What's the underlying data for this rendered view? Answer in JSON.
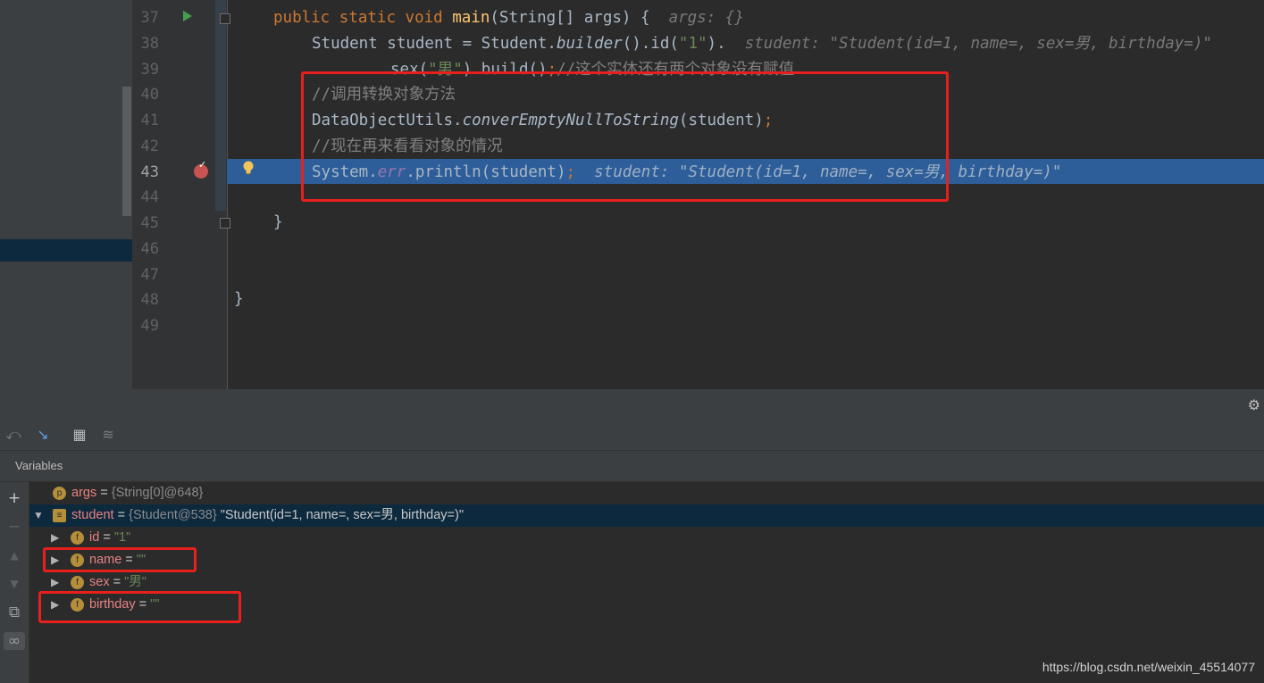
{
  "editor": {
    "line_numbers": [
      "37",
      "38",
      "39",
      "40",
      "41",
      "42",
      "43",
      "44",
      "45",
      "46",
      "47",
      "48",
      "49"
    ],
    "lines": {
      "l37": {
        "kw1": "public",
        "kw2": "static",
        "kw3": "void",
        "fn": "main",
        "rest": "(String[] args) {",
        "hint": "args: {}"
      },
      "l38": {
        "p1": "Student student = Student.",
        "m1": "builder",
        "p2": "().id(",
        "s1": "\"1\"",
        "p3": ").",
        "hint": "student: \"Student(id=1, name=, sex=男, birthday=)\""
      },
      "l39": {
        "p1": "sex(",
        "s1": "\"男\"",
        "p2": ").build()",
        "semi": ";",
        "cmt": "//这个实体还有两个对象没有赋值"
      },
      "l40": {
        "cmt": "//调用转换对象方法"
      },
      "l41": {
        "p1": "DataObjectUtils.",
        "m1": "converEmptyNullToString",
        "p2": "(student)",
        "semi": ";"
      },
      "l42": {
        "cmt": "//现在再来看看对象的情况"
      },
      "l43": {
        "p1": "System.",
        "f1": "err",
        "p2": ".println(student)",
        "semi": ";",
        "hint": "student: \"Student(id=1, name=, sex=男, birthday=)\""
      },
      "l45": {
        "brace": "}"
      },
      "l48": {
        "brace": "}"
      }
    }
  },
  "debugger": {
    "panel_title": "Variables",
    "variables": [
      {
        "badge": "p",
        "name": "args",
        "eq": " = ",
        "ref": "{String[0]@648}",
        "value": ""
      },
      {
        "badge": "≡",
        "name": "student",
        "eq": " = ",
        "ref": "{Student@538}",
        "value": " \"Student(id=1, name=, sex=男, birthday=)\""
      },
      {
        "badge": "f",
        "name": "id",
        "eq": " = ",
        "ref": "",
        "value": "\"1\""
      },
      {
        "badge": "f",
        "name": "name",
        "eq": " = ",
        "ref": "",
        "value": "\"\""
      },
      {
        "badge": "f",
        "name": "sex",
        "eq": " = ",
        "ref": "",
        "value": "\"男\""
      },
      {
        "badge": "f",
        "name": "birthday",
        "eq": " = ",
        "ref": "",
        "value": "\"\""
      }
    ]
  },
  "icons": [
    "run-icon",
    "breakpoint-icon",
    "bulb-icon",
    "fold-icon",
    "restore-icon",
    "step-icon",
    "table-icon",
    "settings-icon",
    "plus-icon",
    "minus-icon",
    "up-icon",
    "down-icon",
    "copy-icon",
    "glasses-icon",
    "gear-icon"
  ],
  "colors": {
    "highlight_box": "#e8201c",
    "execution_line": "#2d5e99",
    "keyword": "#cc7832",
    "string": "#6a8759",
    "method": "#ffc66d"
  },
  "watermark": "https://blog.csdn.net/weixin_45514077"
}
